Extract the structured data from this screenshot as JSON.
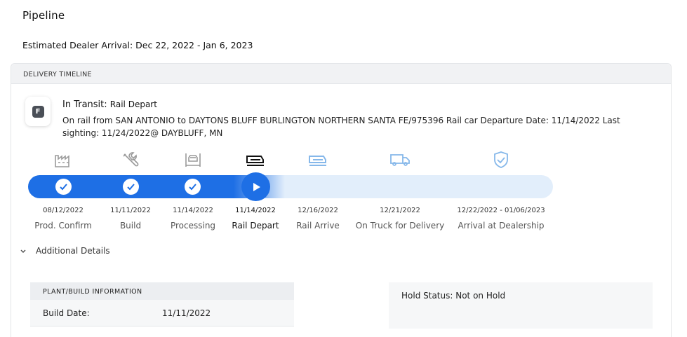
{
  "page": {
    "title": "Pipeline",
    "estimated_arrival": "Estimated Dealer Arrival: Dec 22, 2022 - Jan 6, 2023"
  },
  "timeline": {
    "header": "DELIVERY TIMELINE",
    "badge_letter": "F",
    "status_prefix": "In Transit:",
    "status_stage": "Rail Depart",
    "status_description": "On rail from SAN ANTONIO to DAYTONS BLUFF BURLINGTON NORTHERN SANTA FE/975396 Rail car Departure Date: 11/14/2022 Last sighting: 11/24/2022@ DAYBLUFF, MN",
    "current_stage_index": 3,
    "stages": [
      {
        "date": "08/12/2022",
        "label": "Prod. Confirm",
        "icon": "factory-icon",
        "state": "complete"
      },
      {
        "date": "11/11/2022",
        "label": "Build",
        "icon": "wrench-screwdriver-icon",
        "state": "complete"
      },
      {
        "date": "11/14/2022",
        "label": "Processing",
        "icon": "vehicle-lift-icon",
        "state": "complete"
      },
      {
        "date": "11/14/2022",
        "label": "Rail Depart",
        "icon": "railcar-icon",
        "state": "current"
      },
      {
        "date": "12/16/2022",
        "label": "Rail Arrive",
        "icon": "railcar-icon",
        "state": "upcoming"
      },
      {
        "date": "12/21/2022",
        "label": "On Truck for Delivery",
        "icon": "truck-icon",
        "state": "upcoming"
      },
      {
        "date": "12/22/2022 - 01/06/2023",
        "label": "Arrival at Dealership",
        "icon": "shield-check-icon",
        "state": "upcoming"
      }
    ],
    "colors": {
      "progress": "#1e6fe5",
      "track": "#e2eefb",
      "upcoming_icon": "#86b8ea",
      "done_icon": "#9a9a9a"
    }
  },
  "additional_details": {
    "toggle_label": "Additional Details",
    "toggle_icon": "chevron-down-icon",
    "plant_build": {
      "header": "PLANT/BUILD INFORMATION",
      "build_date_label": "Build Date:",
      "build_date_value": "11/11/2022"
    },
    "hold_status": "Hold Status: Not on Hold"
  }
}
